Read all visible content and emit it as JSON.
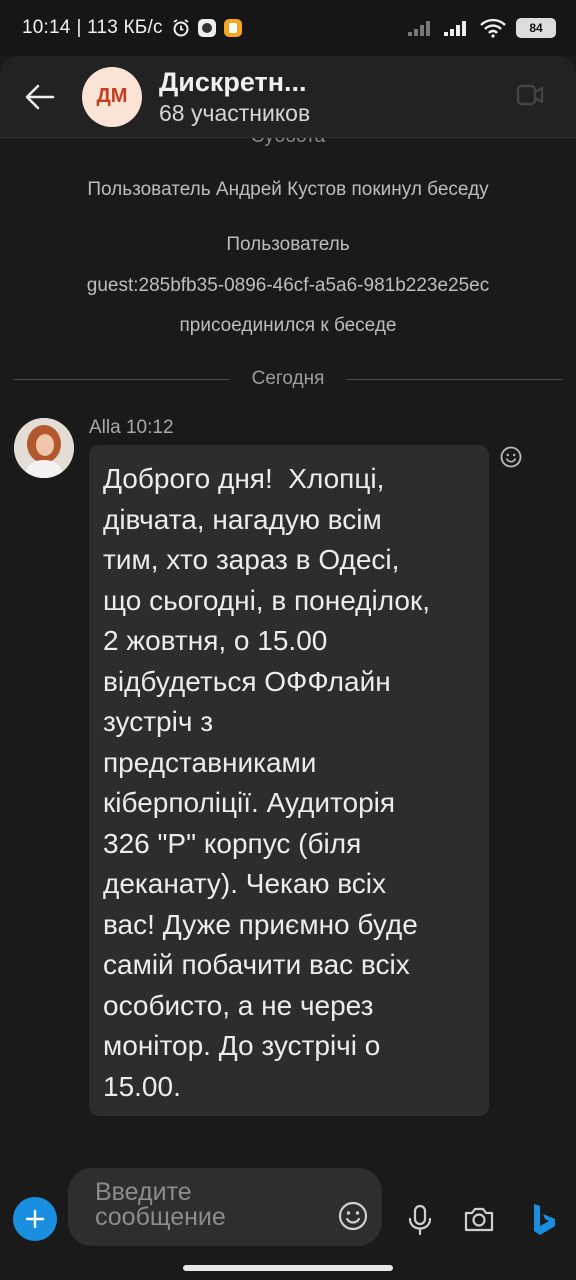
{
  "status_bar": {
    "time": "10:14",
    "network_speed": "| 113 КБ/с",
    "battery": "84"
  },
  "header": {
    "avatar_initials": "ДМ",
    "title": "Дискретн...",
    "subtitle": "68 участников"
  },
  "chat": {
    "previous_day_label": "Суббота",
    "system_messages": [
      "Пользователь Андрей Кустов покинул беседу",
      "Пользователь",
      "guest:285bfb35-0896-46cf-a5a6-981b223e25ec",
      "присоединился к беседе"
    ],
    "day_divider": "Сегодня",
    "message": {
      "author": "Alla",
      "time": "10:12",
      "text": "Доброго дня!  Хлопці,\nдівчата, нагадую всім\nтим, хто зараз в Одесі,\nщо сьогодні, в понеділок,\n2 жовтня, о 15.00\nвідбудеться ОФФлайн\nзустріч з\nпредставниками\nкіберполіції. Аудиторія\n326 \"Р\" корпус (біля\nдеканату). Чекаю всіх\nвас! Дуже приємно буде\nсамій побачити вас всіх\nособисто, а не через\nмонітор. До зустрічі о\n15.00."
    }
  },
  "composer": {
    "placeholder": "Введите\nсообщение"
  },
  "colors": {
    "accent": "#1a8fe0",
    "background": "#1a1a1a",
    "bubble": "#2d2d2d",
    "avatar_bg": "#fbe3d6",
    "avatar_fg": "#c63d1f"
  }
}
